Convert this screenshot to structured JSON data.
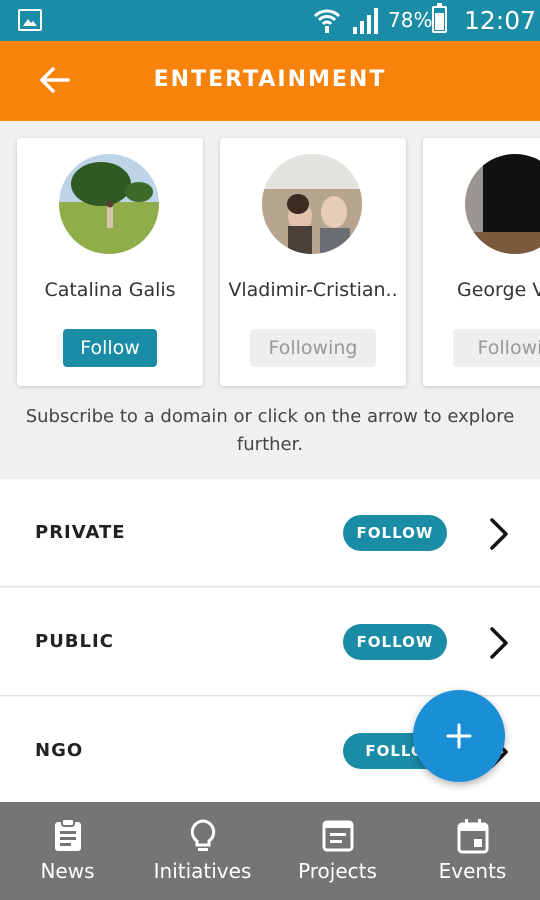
{
  "status_bar": {
    "battery": "78%",
    "time": "12:07",
    "icons": [
      "gallery-icon",
      "wifi-icon",
      "signal-icon",
      "battery-icon"
    ]
  },
  "app_bar": {
    "title": "ENTERTAINMENT",
    "back_icon": "arrow-left-icon",
    "background": "#f7820c"
  },
  "people": [
    {
      "name": "Catalina Galis",
      "button": "Follow"
    },
    {
      "name": "Vladimir-Cristian..",
      "button": "Following"
    },
    {
      "name": "George V",
      "button": "Followin"
    }
  ],
  "hint": "Subscribe to a domain or click on the arrow to explore further.",
  "domains": [
    {
      "label": "PRIVATE",
      "button": "FOLLOW"
    },
    {
      "label": "PUBLIC",
      "button": "FOLLOW"
    },
    {
      "label": "NGO",
      "button": "FOLLO"
    }
  ],
  "fab": {
    "icon": "plus-icon"
  },
  "bottom_nav": [
    {
      "label": "News",
      "icon": "clipboard-icon"
    },
    {
      "label": "Initiatives",
      "icon": "lightbulb-icon"
    },
    {
      "label": "Projects",
      "icon": "document-icon"
    },
    {
      "label": "Events",
      "icon": "calendar-icon"
    }
  ],
  "colors": {
    "accent": "#1a8ca6",
    "status_bar": "#1a8ca6",
    "fab": "#1a8fd6",
    "bottom_nav": "#757575"
  }
}
